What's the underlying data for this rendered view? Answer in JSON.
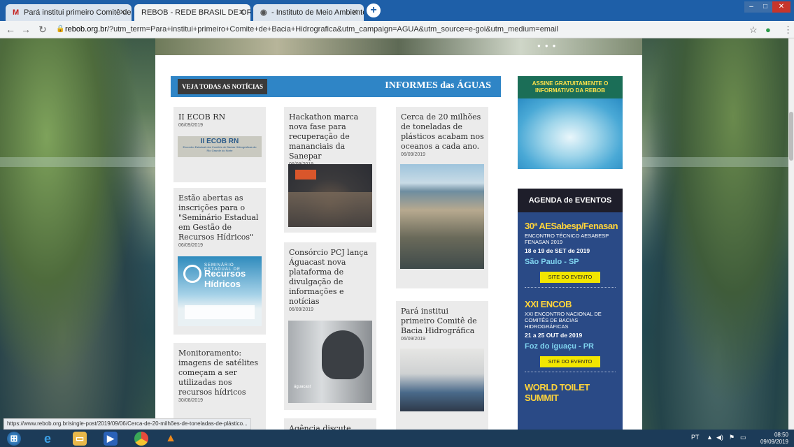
{
  "browser": {
    "tabs": [
      {
        "label": "Pará institui primeiro Comitê de"
      },
      {
        "label": "REBOB - REDE BRASIL DE ORGAI"
      },
      {
        "label": "- Instituto de Meio Ambiente de"
      }
    ],
    "url_domain": "rebob.org.br",
    "url_path": "/?utm_term=Para+institui+primeiro+Comite+de+Bacia+Hidrografica&utm_campaign=AGUA&utm_source=e-goi&utm_medium=email",
    "status_url": "https://www.rebob.org.br/single-post/2019/09/06/Cerca-de-20-milhões-de-toneladas-de-plástico..."
  },
  "news": {
    "all_news_label": "VEJA TODAS AS NOTÍCIAS",
    "section_title": "INFORMES das ÁGUAS",
    "cards": [
      {
        "title": "II ECOB RN",
        "date": "06/09/2019",
        "thumb_title": "II ECOB RN",
        "thumb_sub": "Encontro Estadual dos Comitês de Bacias Hidrográficas do Rio Grande do Norte"
      },
      {
        "title": "Hackathon marca nova fase para recuperação de mananciais da Sanepar",
        "date": "06/09/2019"
      },
      {
        "title": "Cerca de 20 milhões de toneladas de plásticos acabam nos oceanos a cada ano.",
        "date": "06/09/2019"
      },
      {
        "title": "Estão abertas as inscrições para o \"Seminário Estadual em Gestão de Recursos Hídricos\"",
        "date": "06/09/2019",
        "thumb_kicker": "SEMINÁRIO ESTADUAL DE",
        "thumb_title": "Recursos Hídricos"
      },
      {
        "title": "Consórcio PCJ lança Águacast nova plataforma de divulgação de informações e notícias",
        "date": "06/09/2019",
        "thumb_label": "águacast"
      },
      {
        "title": "Pará institui primeiro Comitê de Bacia Hidrográfica",
        "date": "06/09/2019"
      },
      {
        "title": "Monitoramento: imagens de satélites começam a ser utilizadas nos recursos hídricos",
        "date": "30/08/2019"
      },
      {
        "title": "Agência discute agenda"
      }
    ]
  },
  "sidebar": {
    "subscribe_label": "ASSINE GRATUITAMENTE O INFORMATIVO DA REBOB",
    "agenda_title": "AGENDA de EVENTOS",
    "events": [
      {
        "title": "30ª AESabesp/Fenasan",
        "desc": "ENCONTRO TÉCNICO AESABESP FENASAN 2019",
        "date": "18 e 19 de SET de 2019",
        "place": "São Paulo - SP",
        "button": "SITE DO EVENTO"
      },
      {
        "title": "XXI ENCOB",
        "desc": "XXI ENCONTRO NACIONAL DE COMITÊS DE BACIAS HIDROGRÁFICAS",
        "date": "21 a 25 OUT de 2019",
        "place": "Foz do iguaçu - PR",
        "button": "SITE DO EVENTO"
      },
      {
        "title": "WORLD TOILET SUMMIT"
      }
    ]
  },
  "taskbar": {
    "lang": "PT",
    "time": "08:50",
    "date": "09/09/2019"
  }
}
